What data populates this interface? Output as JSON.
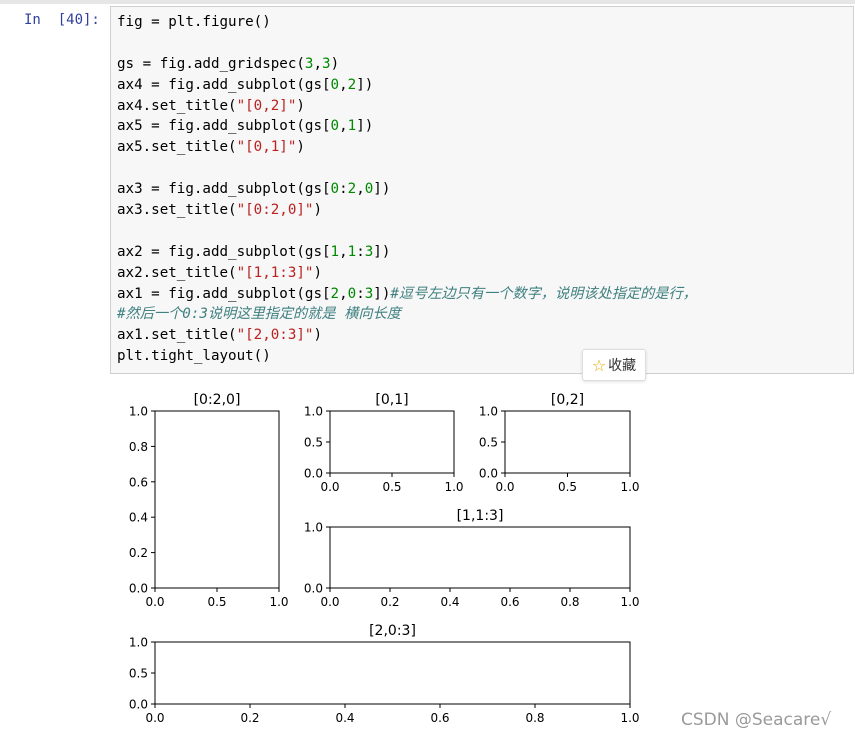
{
  "prompt": "In  [40]:",
  "code_lines": [
    [
      {
        "t": "fig = plt.figure()",
        "c": ""
      }
    ],
    [
      {
        "t": "",
        "c": ""
      }
    ],
    [
      {
        "t": "gs = fig.add_gridspec(",
        "c": ""
      },
      {
        "t": "3",
        "c": "num"
      },
      {
        "t": ",",
        "c": ""
      },
      {
        "t": "3",
        "c": "num"
      },
      {
        "t": ")",
        "c": ""
      }
    ],
    [
      {
        "t": "ax4 = fig.add_subplot(gs[",
        "c": ""
      },
      {
        "t": "0",
        "c": "num"
      },
      {
        "t": ",",
        "c": ""
      },
      {
        "t": "2",
        "c": "num"
      },
      {
        "t": "])",
        "c": ""
      }
    ],
    [
      {
        "t": "ax4.set_title(",
        "c": ""
      },
      {
        "t": "\"[0,2]\"",
        "c": "str"
      },
      {
        "t": ")",
        "c": ""
      }
    ],
    [
      {
        "t": "ax5 = fig.add_subplot(gs[",
        "c": ""
      },
      {
        "t": "0",
        "c": "num"
      },
      {
        "t": ",",
        "c": ""
      },
      {
        "t": "1",
        "c": "num"
      },
      {
        "t": "])",
        "c": ""
      }
    ],
    [
      {
        "t": "ax5.set_title(",
        "c": ""
      },
      {
        "t": "\"[0,1]\"",
        "c": "str"
      },
      {
        "t": ")",
        "c": ""
      }
    ],
    [
      {
        "t": "",
        "c": ""
      }
    ],
    [
      {
        "t": "ax3 = fig.add_subplot(gs[",
        "c": ""
      },
      {
        "t": "0",
        "c": "num"
      },
      {
        "t": ":",
        "c": ""
      },
      {
        "t": "2",
        "c": "num"
      },
      {
        "t": ",",
        "c": ""
      },
      {
        "t": "0",
        "c": "num"
      },
      {
        "t": "])",
        "c": ""
      }
    ],
    [
      {
        "t": "ax3.set_title(",
        "c": ""
      },
      {
        "t": "\"[0:2,0]\"",
        "c": "str"
      },
      {
        "t": ")",
        "c": ""
      }
    ],
    [
      {
        "t": "",
        "c": ""
      }
    ],
    [
      {
        "t": "ax2 = fig.add_subplot(gs[",
        "c": ""
      },
      {
        "t": "1",
        "c": "num"
      },
      {
        "t": ",",
        "c": ""
      },
      {
        "t": "1",
        "c": "num"
      },
      {
        "t": ":",
        "c": ""
      },
      {
        "t": "3",
        "c": "num"
      },
      {
        "t": "])",
        "c": ""
      }
    ],
    [
      {
        "t": "ax2.set_title(",
        "c": ""
      },
      {
        "t": "\"[1,1:3]\"",
        "c": "str"
      },
      {
        "t": ")",
        "c": ""
      }
    ],
    [
      {
        "t": "ax1 = fig.add_subplot(gs[",
        "c": ""
      },
      {
        "t": "2",
        "c": "num"
      },
      {
        "t": ",",
        "c": ""
      },
      {
        "t": "0",
        "c": "num"
      },
      {
        "t": ":",
        "c": ""
      },
      {
        "t": "3",
        "c": "num"
      },
      {
        "t": "])",
        "c": ""
      },
      {
        "t": "#逗号左边只有一个数字，说明该处指定的是行，",
        "c": "cmt"
      }
    ],
    [
      {
        "t": "#然后一个0:3说明这里指定的就是 横向长度",
        "c": "cmt"
      }
    ],
    [
      {
        "t": "ax1.set_title(",
        "c": ""
      },
      {
        "t": "\"[2,0:3]\"",
        "c": "str"
      },
      {
        "t": ")",
        "c": ""
      }
    ],
    [
      {
        "t": "plt.tight_layout()",
        "c": ""
      }
    ]
  ],
  "favorite": {
    "icon": "star-icon",
    "label": "收藏",
    "star_color": "#e5a600"
  },
  "watermark": "CSDN @Seacare√",
  "chart_data": [
    {
      "type": "line",
      "title": "[0:2,0]",
      "xlim": [
        0,
        1
      ],
      "ylim": [
        0,
        1
      ],
      "xticks": [
        "0.0",
        "0.5",
        "1.0"
      ],
      "yticks": [
        "0.0",
        "0.2",
        "0.4",
        "0.6",
        "0.8",
        "1.0"
      ],
      "series": []
    },
    {
      "type": "line",
      "title": "[0,1]",
      "xlim": [
        0,
        1
      ],
      "ylim": [
        0,
        1
      ],
      "xticks": [
        "0.0",
        "0.5",
        "1.0"
      ],
      "yticks": [
        "0.0",
        "0.5",
        "1.0"
      ],
      "series": []
    },
    {
      "type": "line",
      "title": "[0,2]",
      "xlim": [
        0,
        1
      ],
      "ylim": [
        0,
        1
      ],
      "xticks": [
        "0.0",
        "0.5",
        "1.0"
      ],
      "yticks": [
        "0.0",
        "0.5",
        "1.0"
      ],
      "series": []
    },
    {
      "type": "line",
      "title": "[1,1:3]",
      "xlim": [
        0,
        1
      ],
      "ylim": [
        0,
        1
      ],
      "xticks": [
        "0.0",
        "0.2",
        "0.4",
        "0.6",
        "0.8",
        "1.0"
      ],
      "yticks": [
        "0.0",
        "1.0"
      ],
      "series": []
    },
    {
      "type": "line",
      "title": "[2,0:3]",
      "xlim": [
        0,
        1
      ],
      "ylim": [
        0,
        1
      ],
      "xticks": [
        "0.0",
        "0.2",
        "0.4",
        "0.6",
        "0.8",
        "1.0"
      ],
      "yticks": [
        "0.0",
        "0.5",
        "1.0"
      ],
      "series": []
    }
  ]
}
